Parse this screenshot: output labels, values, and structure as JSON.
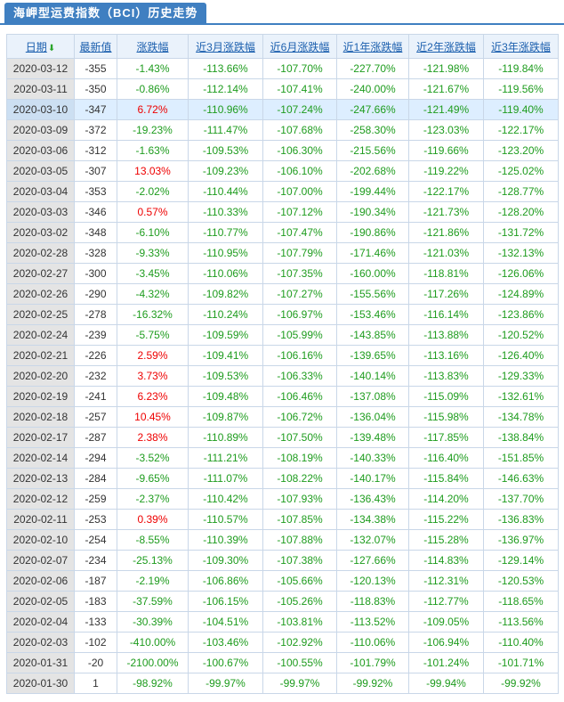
{
  "page_title": "海岬型运费指数（BCI）历史走势",
  "columns": [
    "日期",
    "最新值",
    "涨跌幅",
    "近3月涨跌幅",
    "近6月涨跌幅",
    "近1年涨跌幅",
    "近2年涨跌幅",
    "近3年涨跌幅"
  ],
  "sort_icon": "arrow-down-icon",
  "colors": {
    "positive": "#ee0000",
    "negative": "#1e9c1e",
    "accent": "#3f7fc1"
  },
  "rows": [
    [
      "2020-03-12",
      "-355",
      "-1.43%",
      "-113.66%",
      "-107.70%",
      "-227.70%",
      "-121.98%",
      "-119.84%"
    ],
    [
      "2020-03-11",
      "-350",
      "-0.86%",
      "-112.14%",
      "-107.41%",
      "-240.00%",
      "-121.67%",
      "-119.56%"
    ],
    [
      "2020-03-10",
      "-347",
      "6.72%",
      "-110.96%",
      "-107.24%",
      "-247.66%",
      "-121.49%",
      "-119.40%"
    ],
    [
      "2020-03-09",
      "-372",
      "-19.23%",
      "-111.47%",
      "-107.68%",
      "-258.30%",
      "-123.03%",
      "-122.17%"
    ],
    [
      "2020-03-06",
      "-312",
      "-1.63%",
      "-109.53%",
      "-106.30%",
      "-215.56%",
      "-119.66%",
      "-123.20%"
    ],
    [
      "2020-03-05",
      "-307",
      "13.03%",
      "-109.23%",
      "-106.10%",
      "-202.68%",
      "-119.22%",
      "-125.02%"
    ],
    [
      "2020-03-04",
      "-353",
      "-2.02%",
      "-110.44%",
      "-107.00%",
      "-199.44%",
      "-122.17%",
      "-128.77%"
    ],
    [
      "2020-03-03",
      "-346",
      "0.57%",
      "-110.33%",
      "-107.12%",
      "-190.34%",
      "-121.73%",
      "-128.20%"
    ],
    [
      "2020-03-02",
      "-348",
      "-6.10%",
      "-110.77%",
      "-107.47%",
      "-190.86%",
      "-121.86%",
      "-131.72%"
    ],
    [
      "2020-02-28",
      "-328",
      "-9.33%",
      "-110.95%",
      "-107.79%",
      "-171.46%",
      "-121.03%",
      "-132.13%"
    ],
    [
      "2020-02-27",
      "-300",
      "-3.45%",
      "-110.06%",
      "-107.35%",
      "-160.00%",
      "-118.81%",
      "-126.06%"
    ],
    [
      "2020-02-26",
      "-290",
      "-4.32%",
      "-109.82%",
      "-107.27%",
      "-155.56%",
      "-117.26%",
      "-124.89%"
    ],
    [
      "2020-02-25",
      "-278",
      "-16.32%",
      "-110.24%",
      "-106.97%",
      "-153.46%",
      "-116.14%",
      "-123.86%"
    ],
    [
      "2020-02-24",
      "-239",
      "-5.75%",
      "-109.59%",
      "-105.99%",
      "-143.85%",
      "-113.88%",
      "-120.52%"
    ],
    [
      "2020-02-21",
      "-226",
      "2.59%",
      "-109.41%",
      "-106.16%",
      "-139.65%",
      "-113.16%",
      "-126.40%"
    ],
    [
      "2020-02-20",
      "-232",
      "3.73%",
      "-109.53%",
      "-106.33%",
      "-140.14%",
      "-113.83%",
      "-129.33%"
    ],
    [
      "2020-02-19",
      "-241",
      "6.23%",
      "-109.48%",
      "-106.46%",
      "-137.08%",
      "-115.09%",
      "-132.61%"
    ],
    [
      "2020-02-18",
      "-257",
      "10.45%",
      "-109.87%",
      "-106.72%",
      "-136.04%",
      "-115.98%",
      "-134.78%"
    ],
    [
      "2020-02-17",
      "-287",
      "2.38%",
      "-110.89%",
      "-107.50%",
      "-139.48%",
      "-117.85%",
      "-138.84%"
    ],
    [
      "2020-02-14",
      "-294",
      "-3.52%",
      "-111.21%",
      "-108.19%",
      "-140.33%",
      "-116.40%",
      "-151.85%"
    ],
    [
      "2020-02-13",
      "-284",
      "-9.65%",
      "-111.07%",
      "-108.22%",
      "-140.17%",
      "-115.84%",
      "-146.63%"
    ],
    [
      "2020-02-12",
      "-259",
      "-2.37%",
      "-110.42%",
      "-107.93%",
      "-136.43%",
      "-114.20%",
      "-137.70%"
    ],
    [
      "2020-02-11",
      "-253",
      "0.39%",
      "-110.57%",
      "-107.85%",
      "-134.38%",
      "-115.22%",
      "-136.83%"
    ],
    [
      "2020-02-10",
      "-254",
      "-8.55%",
      "-110.39%",
      "-107.88%",
      "-132.07%",
      "-115.28%",
      "-136.97%"
    ],
    [
      "2020-02-07",
      "-234",
      "-25.13%",
      "-109.30%",
      "-107.38%",
      "-127.66%",
      "-114.83%",
      "-129.14%"
    ],
    [
      "2020-02-06",
      "-187",
      "-2.19%",
      "-106.86%",
      "-105.66%",
      "-120.13%",
      "-112.31%",
      "-120.53%"
    ],
    [
      "2020-02-05",
      "-183",
      "-37.59%",
      "-106.15%",
      "-105.26%",
      "-118.83%",
      "-112.77%",
      "-118.65%"
    ],
    [
      "2020-02-04",
      "-133",
      "-30.39%",
      "-104.51%",
      "-103.81%",
      "-113.52%",
      "-109.05%",
      "-113.56%"
    ],
    [
      "2020-02-03",
      "-102",
      "-410.00%",
      "-103.46%",
      "-102.92%",
      "-110.06%",
      "-106.94%",
      "-110.40%"
    ],
    [
      "2020-01-31",
      "-20",
      "-2100.00%",
      "-100.67%",
      "-100.55%",
      "-101.79%",
      "-101.24%",
      "-101.71%"
    ],
    [
      "2020-01-30",
      "1",
      "-98.92%",
      "-99.97%",
      "-99.97%",
      "-99.92%",
      "-99.94%",
      "-99.92%"
    ]
  ],
  "highlighted_row": 2
}
